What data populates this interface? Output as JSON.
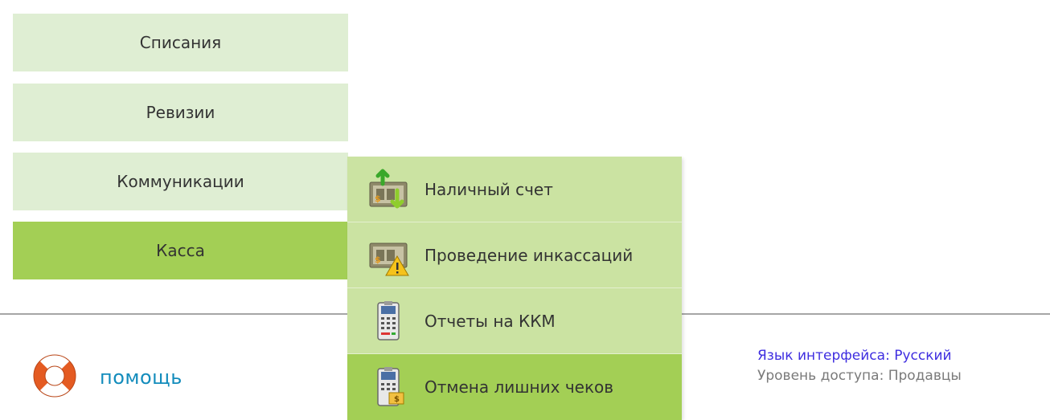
{
  "menu": {
    "items": [
      {
        "label": "Списания"
      },
      {
        "label": "Ревизии"
      },
      {
        "label": "Коммуникации"
      },
      {
        "label": "Касса"
      }
    ]
  },
  "submenu": {
    "items": [
      {
        "label": "Наличный счет",
        "icon": "cash-account-icon"
      },
      {
        "label": "Проведение инкассаций",
        "icon": "cash-collection-warning-icon"
      },
      {
        "label": "Отчеты на ККМ",
        "icon": "cash-register-report-icon"
      },
      {
        "label": "Отмена лишних чеков",
        "icon": "cancel-receipt-icon"
      }
    ]
  },
  "footer": {
    "help_label": "помощь",
    "help_icon": "lifebuoy-icon",
    "language": "Язык интерфейса: Русский",
    "access_level": "Уровень доступа: Продавцы"
  },
  "colors": {
    "menu_bg": "#dfeed3",
    "active_green": "#a3cf55",
    "submenu_bg": "#cbe3a2",
    "help_link": "#138cbc",
    "language_link": "#3f2ee0"
  }
}
